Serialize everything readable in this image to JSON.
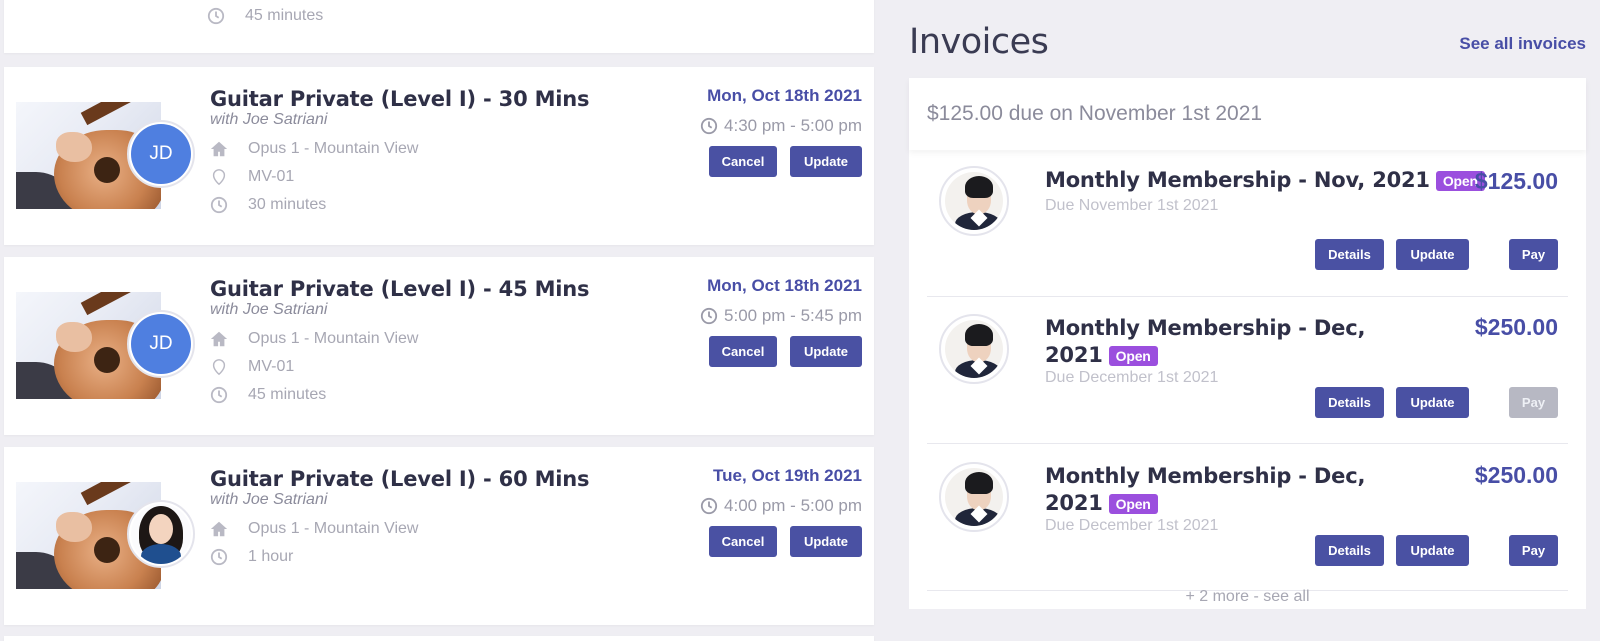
{
  "lessons": {
    "partial_top": {
      "duration": "45 minutes"
    },
    "items": [
      {
        "title": "Guitar Private (Level I) - 30 Mins",
        "instructor": "with Joe Satriani",
        "location": "Opus 1 - Mountain View",
        "room": "MV-01",
        "duration": "30 minutes",
        "date": "Mon, Oct 18th 2021",
        "time": "4:30 pm - 5:00 pm",
        "avatar_initials": "JD",
        "cancel_label": "Cancel",
        "update_label": "Update"
      },
      {
        "title": "Guitar Private (Level I) - 45 Mins",
        "instructor": "with Joe Satriani",
        "location": "Opus 1 - Mountain View",
        "room": "MV-01",
        "duration": "45 minutes",
        "date": "Mon, Oct 18th 2021",
        "time": "5:00 pm - 5:45 pm",
        "avatar_initials": "JD",
        "cancel_label": "Cancel",
        "update_label": "Update"
      },
      {
        "title": "Guitar Private (Level I) - 60 Mins",
        "instructor": "with Joe Satriani",
        "location": "Opus 1 - Mountain View",
        "duration": "1 hour",
        "date": "Tue, Oct 19th 2021",
        "time": "4:00 pm - 5:00 pm",
        "cancel_label": "Cancel",
        "update_label": "Update"
      }
    ]
  },
  "invoices": {
    "title": "Invoices",
    "see_all_label": "See all invoices",
    "due_summary": "$125.00 due on November 1st 2021",
    "status_label": "Open",
    "items": [
      {
        "title": "Monthly Membership - Nov, 2021",
        "amount": "$125.00",
        "due": "Due November 1st 2021",
        "details_label": "Details",
        "update_label": "Update",
        "pay_label": "Pay",
        "pay_enabled": true
      },
      {
        "title": "Monthly Membership - Dec, 2021",
        "amount": "$250.00",
        "due": "Due December 1st 2021",
        "details_label": "Details",
        "update_label": "Update",
        "pay_label": "Pay",
        "pay_enabled": false
      },
      {
        "title": "Monthly Membership - Dec, 2021",
        "amount": "$250.00",
        "due": "Due December 1st 2021",
        "details_label": "Details",
        "update_label": "Update",
        "pay_label": "Pay",
        "pay_enabled": true
      }
    ],
    "more_label": "+ 2 more - see all"
  },
  "colors": {
    "accent": "#484ea6",
    "button": "#4a51a3",
    "badge": "#9b4fde",
    "avatar_initials_bg": "#4f7fe0",
    "disabled_button": "#b7b8c3"
  },
  "icons": {
    "location": "home-icon",
    "room": "map-pin-icon",
    "duration": "clock-icon",
    "time": "clock-icon"
  }
}
